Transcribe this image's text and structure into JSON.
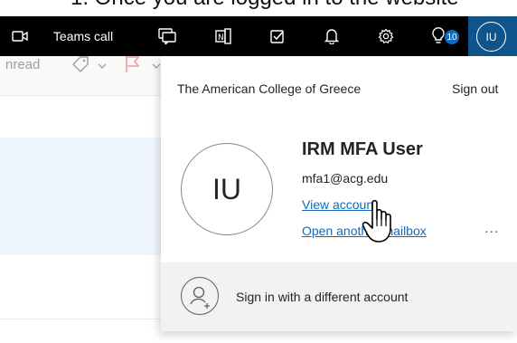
{
  "caption": {
    "text": "1.  Once you are logged in to the website"
  },
  "topbar": {
    "meet_label": "Teams call",
    "notification_count": "10",
    "avatar_initials": "IU",
    "icons": [
      "video-icon",
      "chat-icon",
      "onenote-icon",
      "todo-icon",
      "bell-icon",
      "gear-icon",
      "lightbulb-icon"
    ]
  },
  "background": {
    "unread_label": "nread",
    "icons": [
      "tag-icon",
      "flag-icon"
    ]
  },
  "account": {
    "org_name": "The American College of Greece",
    "sign_out_label": "Sign out",
    "initials": "IU",
    "display_name": "IRM MFA User",
    "email": "mfa1@acg.edu",
    "view_account_label": "View account",
    "open_mailbox_label": "Open another mailbox",
    "more_label": "...",
    "sign_in_other_label": "Sign in with a different account"
  },
  "colors": {
    "topbar": "#000000",
    "accent": "#0f6cbd",
    "avatar_bg": "#0f548c",
    "footer_bg": "#f3f2f1"
  }
}
